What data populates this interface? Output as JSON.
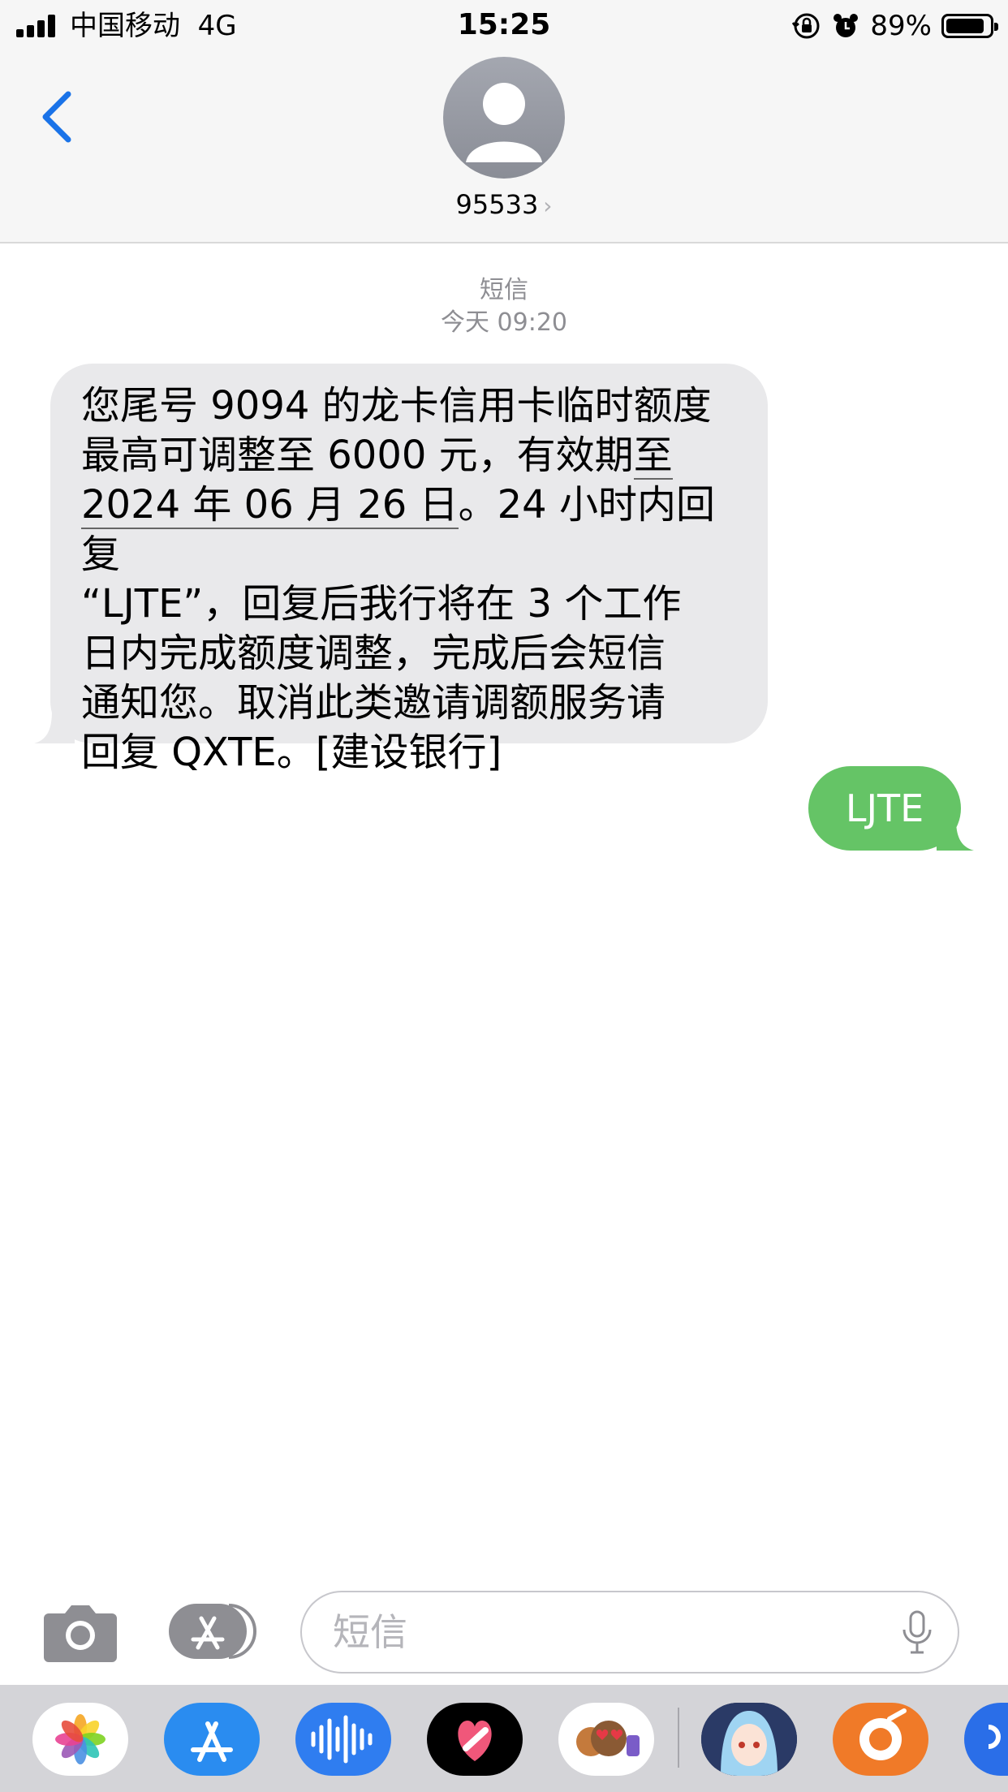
{
  "status_bar": {
    "carrier": "中国移动",
    "network": "4G",
    "time": "15:25",
    "battery_percent": "89%",
    "battery_level": 0.89,
    "icons": [
      "signal-icon",
      "orientation-lock-icon",
      "alarm-icon",
      "battery-icon"
    ]
  },
  "nav": {
    "back_icon": "chevron-left-icon",
    "contact_name": "95533",
    "contact_chevron": "›",
    "avatar_icon": "person-silhouette-icon"
  },
  "conversation": {
    "label": "短信",
    "timestamp": "今天 09:20",
    "incoming": {
      "text_before": "您尾号 9094 的龙卡信用卡临时额度\n最高可调整至 6000 元，有效期",
      "text_link": "至\n2024 年 06 月 26 日",
      "text_after": "。24 小时内回复\n“LJTE”，回复后我行将在 3 个工作\n日内完成额度调整，完成后会短信\n通知您。取消此类邀请调额服务请\n回复 QXTE。[建设银行]"
    },
    "outgoing": {
      "text": "LJTE"
    }
  },
  "input_bar": {
    "placeholder": "短信",
    "camera_icon": "camera-icon",
    "apps_icon": "app-store-icon",
    "mic_icon": "microphone-icon"
  },
  "app_drawer": {
    "apps": [
      "photos-icon",
      "app-store-icon",
      "audio-message-icon",
      "digital-touch-icon",
      "memoji-icon",
      "anime-sticker-icon",
      "qq-browser-icon",
      "partial-app-icon"
    ]
  },
  "colors": {
    "accent_blue": "#1a73e8",
    "incoming_bubble": "#e9e9eb",
    "outgoing_bubble": "#65c466",
    "header_bg": "#f6f6f6",
    "secondary_text": "#8e8e93"
  }
}
